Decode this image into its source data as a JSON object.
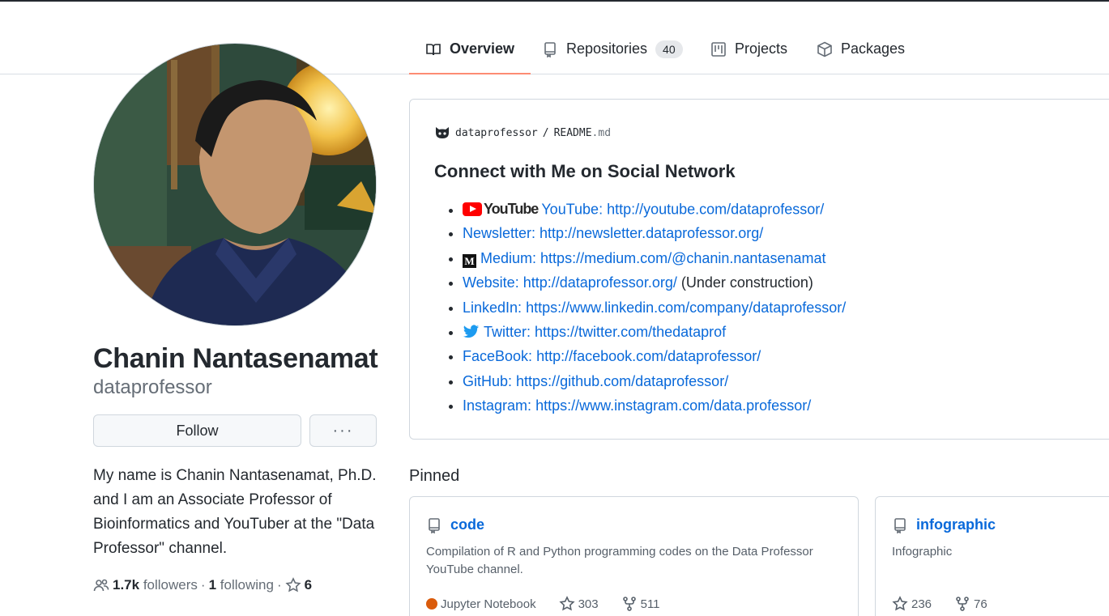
{
  "tabs": [
    {
      "label": "Overview",
      "icon": "book-icon",
      "active": true
    },
    {
      "label": "Repositories",
      "icon": "repo-icon",
      "count": "40"
    },
    {
      "label": "Projects",
      "icon": "project-icon"
    },
    {
      "label": "Packages",
      "icon": "package-icon"
    }
  ],
  "profile": {
    "name": "Chanin Nantasenamat",
    "login": "dataprofessor",
    "follow_label": "Follow",
    "more_label": "···",
    "bio": "My name is Chanin Nantasenamat, Ph.D. and I am an Associate Professor of Bioinformatics and YouTuber at the \"Data Professor\" channel.",
    "followers_count": "1.7k",
    "followers_label": "followers",
    "separator": "·",
    "following_count": "1",
    "following_label": "following",
    "stars_count": "6"
  },
  "readme": {
    "owner": "dataprofessor",
    "slash": "/",
    "file": "README",
    "ext": ".md",
    "heading": "Connect with Me on Social Network",
    "youtube_logo_text": "YouTube",
    "medium_logo_text": "M",
    "links": [
      {
        "label": "YouTube:",
        "url": "http://youtube.com/dataprofessor/",
        "suffix": "",
        "icon": "youtube-logo-icon"
      },
      {
        "label": "Newsletter:",
        "url": "http://newsletter.dataprofessor.org/",
        "suffix": "",
        "icon": ""
      },
      {
        "label": "Medium:",
        "url": "https://medium.com/@chanin.nantasenamat",
        "suffix": "",
        "icon": "medium-logo-icon"
      },
      {
        "label": "Website:",
        "url": "http://dataprofessor.org/",
        "suffix": " (Under construction)",
        "icon": ""
      },
      {
        "label": "LinkedIn:",
        "url": "https://www.linkedin.com/company/dataprofessor/",
        "suffix": "",
        "icon": ""
      },
      {
        "label": "Twitter:",
        "url": "https://twitter.com/thedataprof",
        "suffix": "",
        "icon": "twitter-bird-icon"
      },
      {
        "label": "FaceBook:",
        "url": "http://facebook.com/dataprofessor/",
        "suffix": "",
        "icon": ""
      },
      {
        "label": "GitHub:",
        "url": "https://github.com/dataprofessor/",
        "suffix": "",
        "icon": ""
      },
      {
        "label": "Instagram:",
        "url": "https://www.instagram.com/data.professor/",
        "suffix": "",
        "icon": ""
      }
    ]
  },
  "pinned": {
    "title": "Pinned",
    "repos": [
      {
        "name": "code",
        "description": "Compilation of R and Python programming codes on the Data Professor YouTube channel.",
        "language": "Jupyter Notebook",
        "language_color": "#DA5B0B",
        "stars": "303",
        "forks": "511"
      },
      {
        "name": "infographic",
        "description": "Infographic",
        "stars": "236",
        "forks": "76"
      }
    ]
  },
  "colors": {
    "accent_link": "#0969da",
    "tab_underline": "#fd8c73"
  }
}
